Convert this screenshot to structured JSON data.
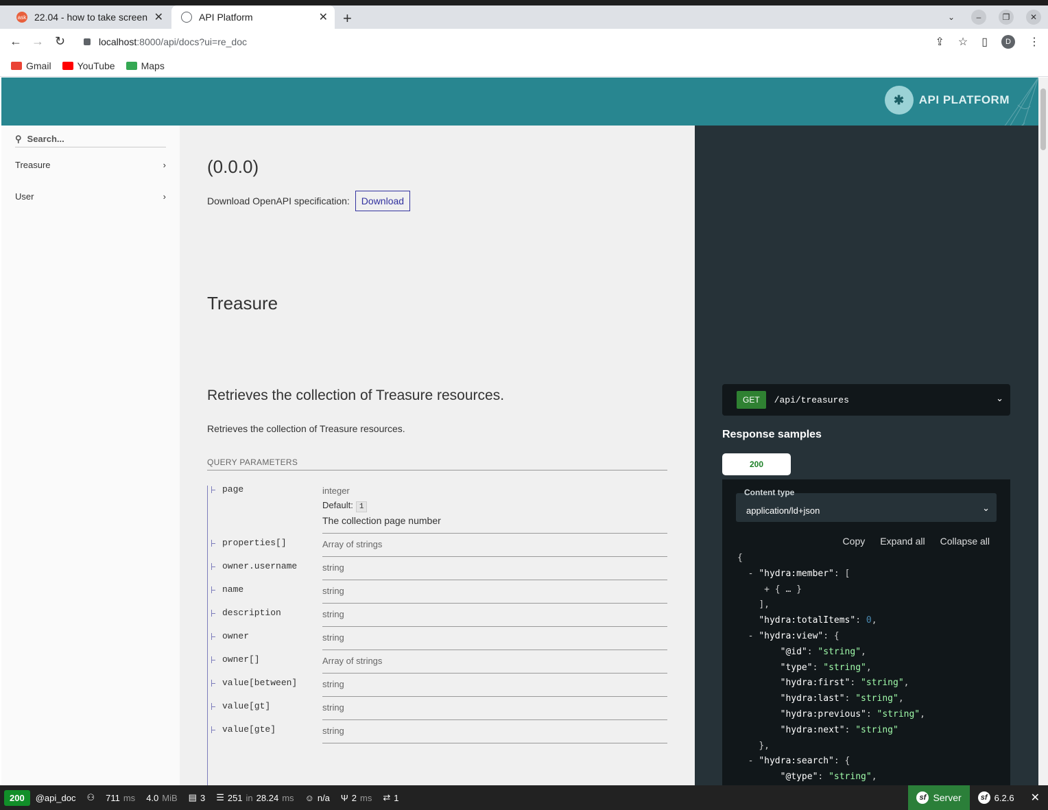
{
  "browser": {
    "tabs": [
      {
        "title": "22.04 - how to take screen",
        "favicon": "ask"
      },
      {
        "title": "API Platform",
        "favicon": "globe-icon"
      }
    ],
    "url_host": "localhost",
    "url_path": ":8000/api/docs?ui=re_doc",
    "profile_initial": "D",
    "bookmarks": [
      "Gmail",
      "YouTube",
      "Maps"
    ]
  },
  "header": {
    "brand": "API PLATFORM",
    "accent": "#288690"
  },
  "sidebar": {
    "search_placeholder": "Search...",
    "items": [
      {
        "label": "Treasure"
      },
      {
        "label": "User"
      }
    ]
  },
  "main": {
    "version": "(0.0.0)",
    "download_label": "Download OpenAPI specification:",
    "download_button": "Download",
    "section_title": "Treasure",
    "operation_title": "Retrieves the collection of Treasure resources.",
    "operation_description": "Retrieves the collection of Treasure resources.",
    "query_params_title": "QUERY PARAMETERS",
    "params": [
      {
        "name": "page",
        "type": "integer",
        "default_label": "Default:",
        "default_value": "1",
        "description": "The collection page number"
      },
      {
        "name": "properties[]",
        "type": "Array of strings"
      },
      {
        "name": "owner.username",
        "type": "string"
      },
      {
        "name": "name",
        "type": "string"
      },
      {
        "name": "description",
        "type": "string"
      },
      {
        "name": "owner",
        "type": "string"
      },
      {
        "name": "owner[]",
        "type": "Array of strings"
      },
      {
        "name": "value[between]",
        "type": "string"
      },
      {
        "name": "value[gt]",
        "type": "string"
      },
      {
        "name": "value[gte]",
        "type": "string"
      }
    ]
  },
  "right_panel": {
    "method": "GET",
    "path": "/api/treasures",
    "response_samples_title": "Response samples",
    "status_tab": "200",
    "content_type_label": "Content type",
    "content_type_value": "application/ld+json",
    "actions": [
      "Copy",
      "Expand all",
      "Collapse all"
    ]
  },
  "toolbar": {
    "status": "200",
    "route": "@api_doc",
    "time_value": "711",
    "time_unit": "ms",
    "memory_value": "4.0",
    "memory_unit": "MiB",
    "requests": "3",
    "cache_calls": "251",
    "cache_in": "in",
    "cache_time": "28.24",
    "cache_unit": "ms",
    "user": "n/a",
    "twig_time": "2",
    "twig_unit": "ms",
    "http_calls": "1",
    "server_label": "Server",
    "symfony_version": "6.2.6"
  }
}
